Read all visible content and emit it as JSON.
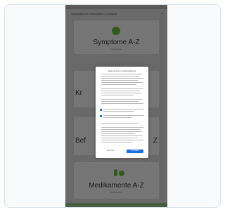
{
  "header": {
    "title": "Sympatros für Gesundheit & Medizin",
    "close_icon": "close-icon"
  },
  "tiles": [
    {
      "label": "Symptome A-Z",
      "subtitle": "Symptome"
    },
    {
      "label": "Kr",
      "subtitle": "",
      "right_label": ""
    },
    {
      "label": "Bef",
      "subtitle": "",
      "right_label": "Z"
    },
    {
      "label": "Medikamente A-Z",
      "subtitle": "Medikamente"
    }
  ],
  "modal": {
    "title": "Datenschutz und Einwilligung",
    "buttons": {
      "secondary": "ABLEHNEN",
      "primary": "ZUSTIMMEN"
    }
  },
  "colors": {
    "green": "#3a6b21",
    "blue": "#1d6fe0"
  }
}
